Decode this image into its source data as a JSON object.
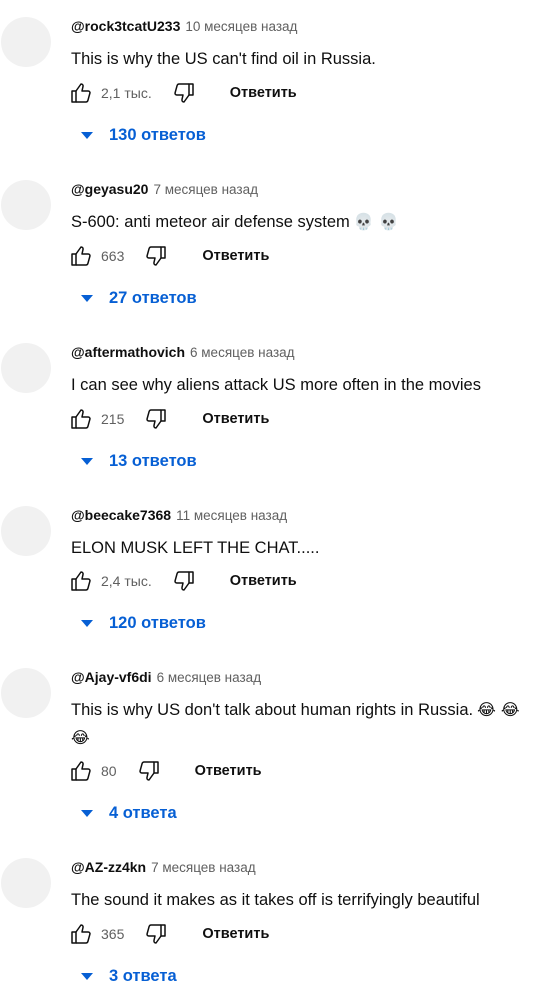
{
  "comments": [
    {
      "author": "@rock3tcatU233",
      "time": "10 месяцев назад",
      "text": "This is why the US can't find oil in Russia.",
      "emoji": "",
      "likes": "2,1 тыс.",
      "reply_label": "Ответить",
      "replies_label": "130 ответов",
      "like_icon": "thumbs-up-icon",
      "dislike_icon": "thumbs-down-icon"
    },
    {
      "author": "@geyasu20",
      "time": "7 месяцев назад",
      "text": "S-600: anti meteor air defense system",
      "emoji": "💀 💀",
      "likes": "663",
      "reply_label": "Ответить",
      "replies_label": "27 ответов",
      "like_icon": "thumbs-up-icon",
      "dislike_icon": "thumbs-down-icon"
    },
    {
      "author": "@aftermathovich",
      "time": "6 месяцев назад",
      "text": "I can see why aliens attack US more often in the movies",
      "emoji": "",
      "likes": "215",
      "reply_label": "Ответить",
      "replies_label": "13 ответов",
      "like_icon": "thumbs-up-icon",
      "dislike_icon": "thumbs-down-icon"
    },
    {
      "author": "@beecake7368",
      "time": "11 месяцев назад",
      "text": "ELON MUSK LEFT THE CHAT.....",
      "emoji": "",
      "likes": "2,4 тыс.",
      "reply_label": "Ответить",
      "replies_label": "120 ответов",
      "like_icon": "thumbs-up-icon",
      "dislike_icon": "thumbs-down-icon"
    },
    {
      "author": "@Ajay-vf6di",
      "time": "6 месяцев назад",
      "text": "This is why US don't talk about human rights in Russia.",
      "emoji": "😂 😂 😂",
      "likes": "80",
      "reply_label": "Ответить",
      "replies_label": "4 ответа",
      "like_icon": "thumbs-up-icon",
      "dislike_icon": "thumbs-down-icon"
    },
    {
      "author": "@AZ-zz4kn",
      "time": "7 месяцев назад",
      "text": "The sound it makes as it takes off is terrifyingly beautiful",
      "emoji": "",
      "likes": "365",
      "reply_label": "Ответить",
      "replies_label": "3 ответа",
      "like_icon": "thumbs-up-icon",
      "dislike_icon": "thumbs-down-icon"
    }
  ],
  "colors": {
    "link_blue": "#065fd4",
    "meta_gray": "#606060",
    "avatar_placeholder": "#f1f1f1"
  }
}
